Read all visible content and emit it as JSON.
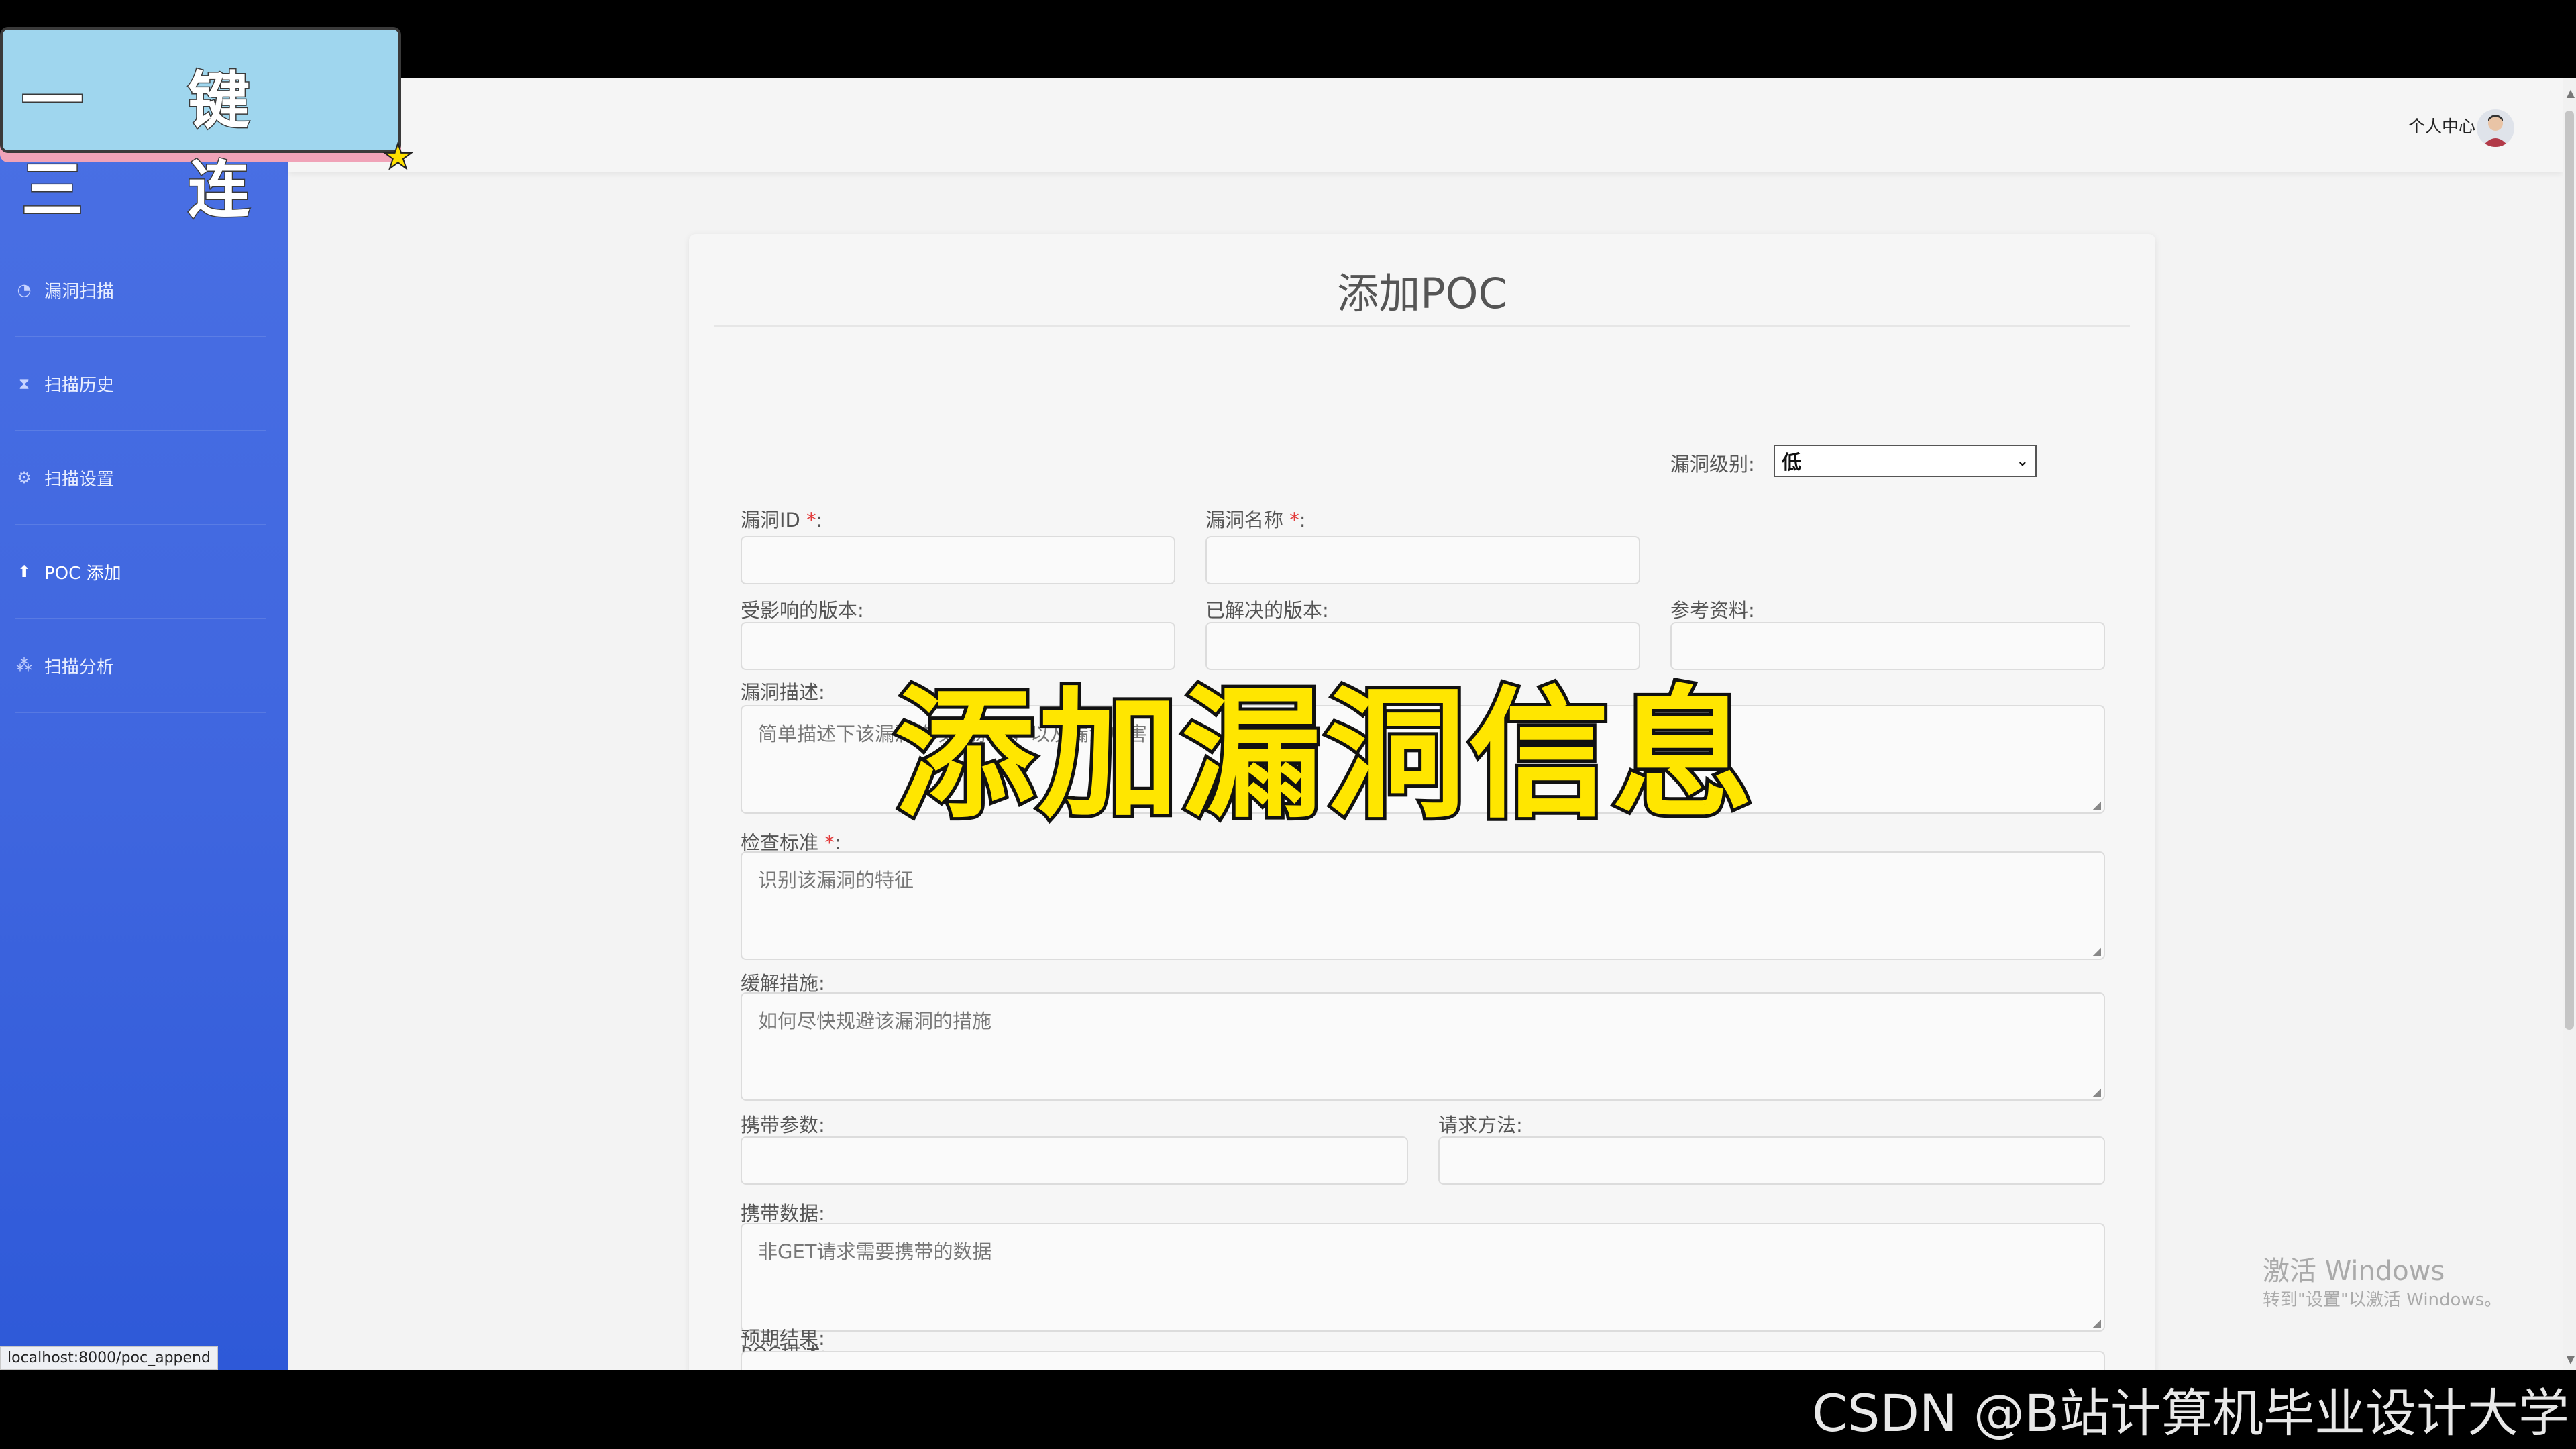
{
  "overlay": {
    "badge_text": "一 键 三 连",
    "caption": "添加漏洞信息",
    "bottom_watermark": "CSDN @B站计算机毕业设计大学"
  },
  "header": {
    "user_center": "个人中心"
  },
  "sidebar": {
    "items": [
      {
        "label": "漏洞扫描",
        "icon": "dashboard-icon"
      },
      {
        "label": "扫描历史",
        "icon": "hourglass-icon"
      },
      {
        "label": "扫描设置",
        "icon": "gear-icon"
      },
      {
        "label": "POC 添加",
        "icon": "upload-icon"
      },
      {
        "label": "扫描分析",
        "icon": "chart-icon"
      }
    ]
  },
  "form": {
    "title": "添加POC",
    "fields": {
      "vuln_id": {
        "label": "漏洞ID",
        "required_mark": "*",
        "suffix": ":"
      },
      "vuln_name": {
        "label": "漏洞名称",
        "required_mark": "*",
        "suffix": ":"
      },
      "vuln_level": {
        "label": "漏洞级别:",
        "value": "低"
      },
      "affected_version": {
        "label": "受影响的版本:"
      },
      "fixed_version": {
        "label": "已解决的版本:"
      },
      "references": {
        "label": "参考资料:"
      },
      "description": {
        "label": "漏洞描述:",
        "placeholder": "简单描述下该漏洞的攻击原理，以及漏洞危害"
      },
      "check_standard": {
        "label": "检查标准",
        "required_mark": "*",
        "suffix": ":",
        "placeholder": "识别该漏洞的特征"
      },
      "mitigation": {
        "label": "缓解措施:",
        "placeholder": "如何尽快规避该漏洞的措施"
      },
      "params": {
        "label": "携带参数:"
      },
      "method": {
        "label": "请求方法:"
      },
      "body_data": {
        "label": "携带数据:",
        "placeholder": "非GET请求需要携带的数据"
      },
      "poc_desc": {
        "label": "POC描述:"
      },
      "expected": {
        "label": "预期结果:"
      }
    }
  },
  "status_bar": {
    "url": "localhost:8000/poc_append"
  },
  "windows_watermark": {
    "line1": "激活 Windows",
    "line2": "转到\"设置\"以激活 Windows。"
  },
  "colors": {
    "sidebar": "#4a70e4",
    "caption": "#ffe600",
    "required": "#e23b3b"
  }
}
